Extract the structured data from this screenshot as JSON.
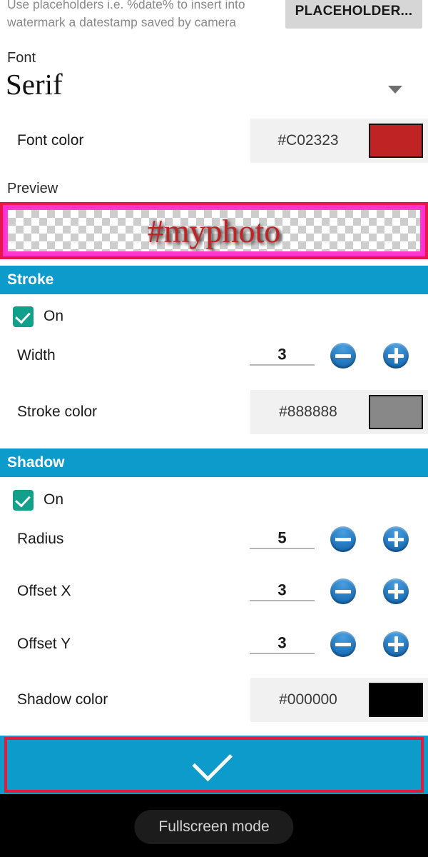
{
  "hint": {
    "text": "Use placeholders i.e. %date% to insert into watermark a datestamp saved by camera",
    "placeholder_button": "PLACEHOLDER..."
  },
  "font": {
    "caption": "Font",
    "value": "Serif"
  },
  "font_color": {
    "label": "Font color",
    "hex": "#C02323"
  },
  "preview": {
    "caption": "Preview",
    "text": "#myphoto"
  },
  "stroke": {
    "header": "Stroke",
    "toggle_label": "On",
    "width_label": "Width",
    "width_value": "3",
    "color_label": "Stroke color",
    "color_hex": "#888888"
  },
  "shadow": {
    "header": "Shadow",
    "toggle_label": "On",
    "radius_label": "Radius",
    "radius_value": "5",
    "offset_x_label": "Offset X",
    "offset_x_value": "3",
    "offset_y_label": "Offset Y",
    "offset_y_value": "3",
    "color_label": "Shadow color",
    "color_hex": "#000000"
  },
  "toast": {
    "text": "Fullscreen mode"
  }
}
